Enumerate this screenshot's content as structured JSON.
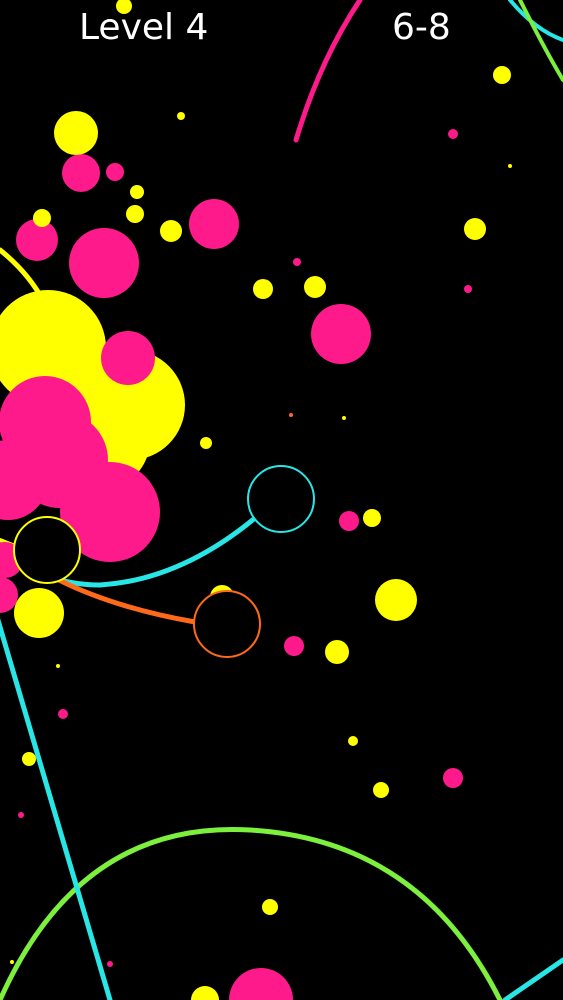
{
  "hud": {
    "level_label": "Level 4",
    "score_label": "6-8"
  },
  "colors": {
    "background": "#000000",
    "yellow": "#ffff00",
    "magenta": "#ff1a8c",
    "cyan": "#29e6e6",
    "orange": "#ff6a1a",
    "green": "#7cf03c"
  },
  "objects": {
    "player_circles": [
      {
        "name": "yellow-ring-player",
        "color": "yellow"
      },
      {
        "name": "cyan-ring-player",
        "color": "cyan"
      },
      {
        "name": "orange-ring-player",
        "color": "orange"
      }
    ],
    "trails": [
      "cyan",
      "orange",
      "yellow",
      "green",
      "magenta"
    ]
  }
}
